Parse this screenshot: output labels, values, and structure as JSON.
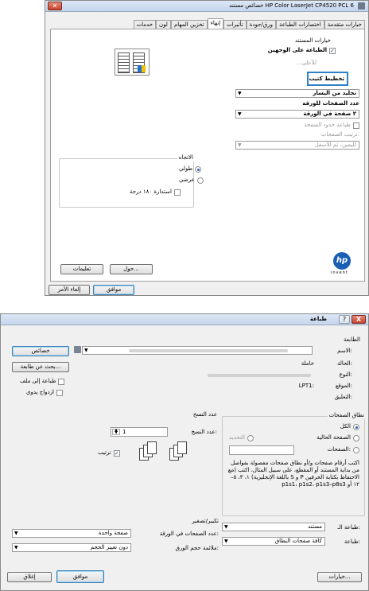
{
  "props": {
    "title": "خصائص مستند HP Color LaserJet CP4520 PCL 6",
    "tabs": [
      "خيارات متقدمة",
      "اختصارات الطباعة",
      "ورق/جودة",
      "تأثيرات",
      "إنهاء",
      "تخزين المهام",
      "لون",
      "خدمات"
    ],
    "active_tab": "إنهاء",
    "doc_options": "خيارات المستند",
    "duplex_label": "الطباعة على الوجهين",
    "flip_label": "...للأعلى",
    "booklet_tooltip": "تخطيط كتيب",
    "booklet_value": "تجليد من اليسار",
    "pages_per_sheet_label": "عدد الصفحات للورقة",
    "pages_per_sheet_value": "٢ صفحة في الورقة",
    "print_borders": "طباعة حدود الصفحة",
    "page_order_label": "ترتيب الصفحات:",
    "page_order_value": "لليمين، ثم للأسفل",
    "orientation_label": "الاتجاه",
    "portrait": "طولي",
    "landscape": "عرضي",
    "rotate": "استدارة ١٨٠ درجة",
    "about_button": "حول...",
    "help_button": "تعليمات",
    "ok_button": "موافق",
    "cancel_button": "إلغاء الأمر",
    "hp_tagline": "invent",
    "hp_logo": "hp"
  },
  "print": {
    "title": "طباعة",
    "help_icon": "?",
    "close_icon": "X",
    "printer_group": "الطابعة",
    "name_label": "الاسم:",
    "status_label": "الحالة:",
    "status_value": "خاملة",
    "type_label": "النوع:",
    "where_label": "الموقع:",
    "where_value": "LPT1:",
    "comment_label": "التعليق:",
    "properties_button": "خصائص",
    "find_printer_button": "بحث عن طابعة...",
    "print_to_file": "طباعة إلى ملف",
    "manual_duplex": "ازدواج يدوي",
    "range_group": "نطاق الصفحات",
    "all": "الكل",
    "current_page": "الصفحة الحالية",
    "selection": "التحديد",
    "pages": "الصفحات:",
    "range_help": "اكتب أرقام صفحات و/أو نطاق صفحات مفصولة بفواصل من بداية المستند أو المقطع، على سبيل المثال، اكتب (مع الاحتفاظ بكتابة الحرفين P و S باللغة الإنجليزية) ١، ٣، ٥–١٢ أو p1s1، p1s2، p1s3–p8s3",
    "copies_group": "عدد النسخ",
    "copies_label": "عدد النسخ:",
    "copies_value": "1",
    "collate": "ترتيب",
    "zoom_group": "تكبير/تصغير",
    "pps_label": "عدد الصفحات في الورقة:",
    "pps_value": "صفحة واحدة",
    "scale_label": "ملائمة حجم الورق:",
    "scale_value": "دون تغيير الحجم",
    "print_what_label": "طباعة الـ:",
    "print_what_value": "مستند",
    "print_label": "طباعة:",
    "print_value": "كافة صفحات النطاق",
    "options_button": "خيارات...",
    "ok_button": "موافق",
    "close_button": "إغلاق"
  }
}
